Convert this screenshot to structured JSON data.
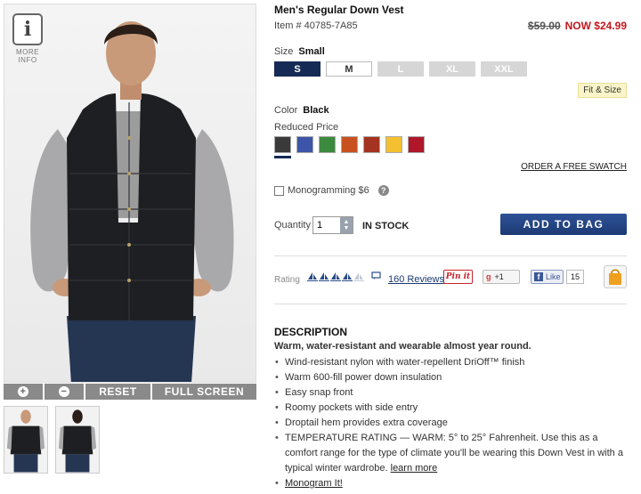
{
  "product": {
    "title": "Men's Regular Down Vest",
    "item_number": "Item # 40785-7A85",
    "old_price": "$59.00",
    "now_price": "NOW $24.99"
  },
  "image_viewer": {
    "info_label": "MORE INFO",
    "info_icon": "i",
    "zoom_in": "+",
    "zoom_out": "−",
    "reset_label": "RESET",
    "fullscreen_label": "FULL SCREEN"
  },
  "size": {
    "label": "Size",
    "selected": "Small",
    "options": [
      {
        "label": "S",
        "state": "selected"
      },
      {
        "label": "M",
        "state": "available"
      },
      {
        "label": "L",
        "state": "unavailable"
      },
      {
        "label": "XL",
        "state": "unavailable"
      },
      {
        "label": "XXL",
        "state": "unavailable"
      }
    ],
    "fit_link": "Fit & Size"
  },
  "color": {
    "label": "Color",
    "selected": "Black",
    "reduced_label": "Reduced Price",
    "swatches": [
      "#3a3a3a",
      "#3d55a8",
      "#3c8a3e",
      "#c8521f",
      "#a43322",
      "#f3c12f",
      "#b0172a"
    ],
    "order_swatch_link": "ORDER A FREE SWATCH"
  },
  "monogram": {
    "label": "Monogramming $6",
    "help_icon": "?"
  },
  "purchase": {
    "quantity_label": "Quantity",
    "quantity_value": "1",
    "stock_status": "IN STOCK",
    "add_to_bag": "ADD TO BAG"
  },
  "social": {
    "rating_label": "Rating",
    "rating_value": 4,
    "rating_max": 5,
    "reviews_link": "160 Reviews",
    "pinit": "Pin it",
    "gplus": "+1",
    "facebook": "Like",
    "facebook_count": "15"
  },
  "description": {
    "heading": "DESCRIPTION",
    "summary": "Warm, water-resistant and wearable almost year round.",
    "bullets": [
      "Wind-resistant nylon with water-repellent DriOff™ finish",
      "Warm 600-fill power down insulation",
      "Easy snap front",
      "Roomy pockets with side entry",
      "Droptail hem provides extra coverage"
    ],
    "temperature": "TEMPERATURE RATING — WARM: 5° to 25° Fahrenheit. Use this as a comfort range for the type of climate you'll be wearing this Down Vest in with a typical winter wardrobe.",
    "learn_more": "learn more",
    "monogram_link": "Monogram It!"
  }
}
